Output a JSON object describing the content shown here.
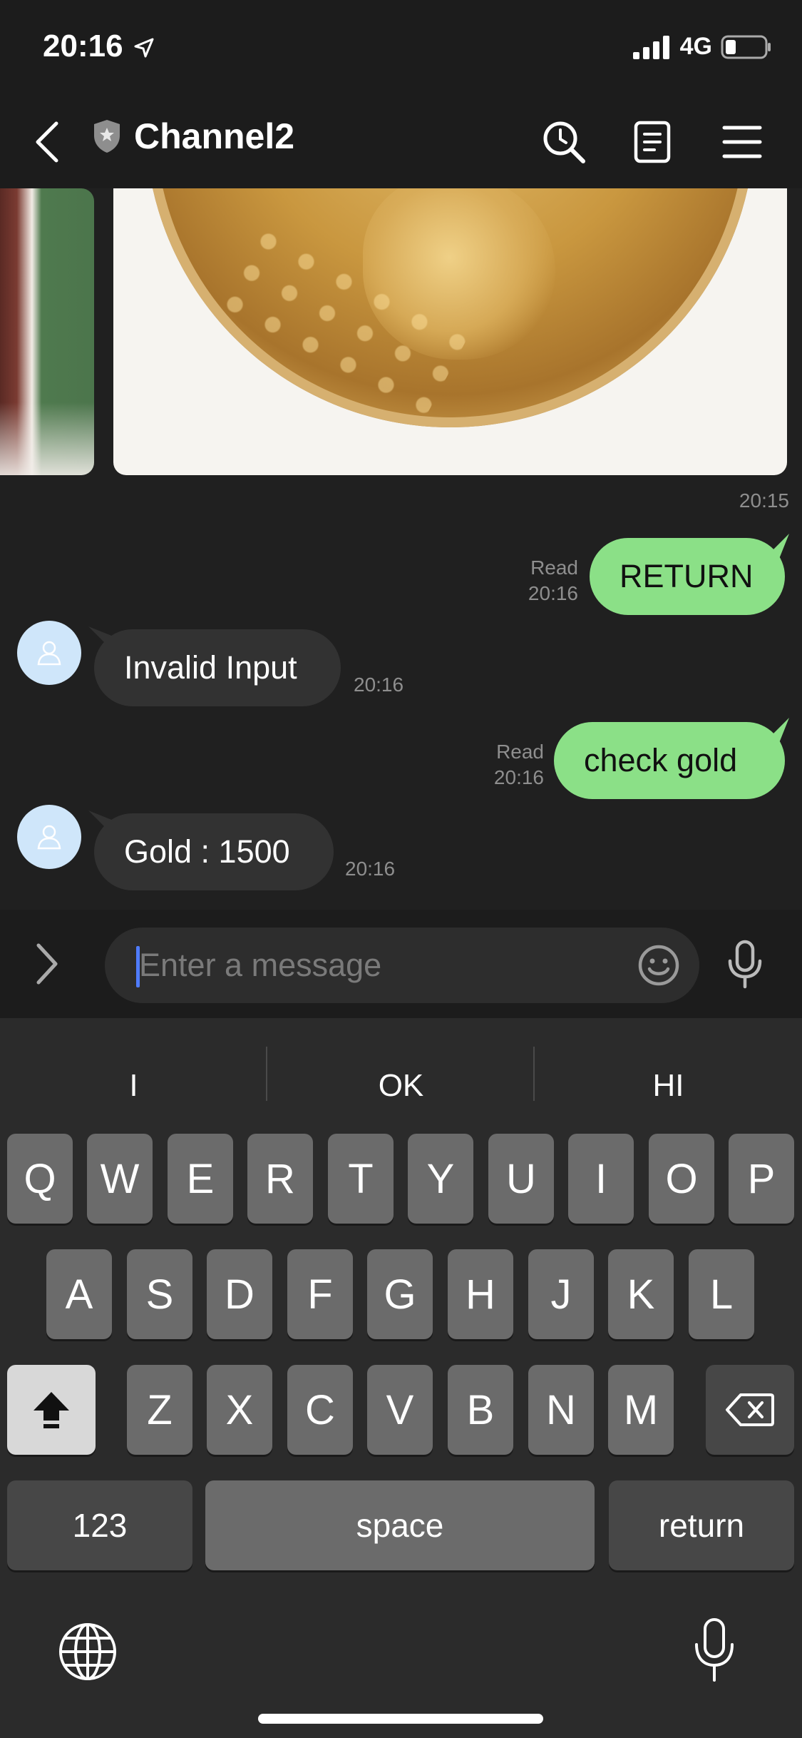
{
  "status": {
    "time": "20:16",
    "network": "4G"
  },
  "header": {
    "title": "Channel2"
  },
  "media": {
    "caption": "coin",
    "time": "20:15"
  },
  "messages": [
    {
      "side": "sent",
      "text": "RETURN",
      "status": "Read",
      "time": "20:16"
    },
    {
      "side": "received",
      "text": "Invalid Input",
      "time": "20:16"
    },
    {
      "side": "sent",
      "text": "check gold",
      "status": "Read",
      "time": "20:16"
    },
    {
      "side": "received",
      "text": "Gold : 1500",
      "time": "20:16"
    }
  ],
  "input": {
    "placeholder": "Enter a message",
    "value": ""
  },
  "keyboard": {
    "suggestions": [
      "I",
      "OK",
      "HI"
    ],
    "row1": [
      "Q",
      "W",
      "E",
      "R",
      "T",
      "Y",
      "U",
      "I",
      "O",
      "P"
    ],
    "row2": [
      "A",
      "S",
      "D",
      "F",
      "G",
      "H",
      "J",
      "K",
      "L"
    ],
    "row3": [
      "Z",
      "X",
      "C",
      "V",
      "B",
      "N",
      "M"
    ],
    "numbers": "123",
    "space": "space",
    "return": "return"
  },
  "colors": {
    "sent_bubble": "#8be087",
    "received_bubble": "#323232",
    "background": "#202020",
    "cursor": "#4f7cff"
  }
}
